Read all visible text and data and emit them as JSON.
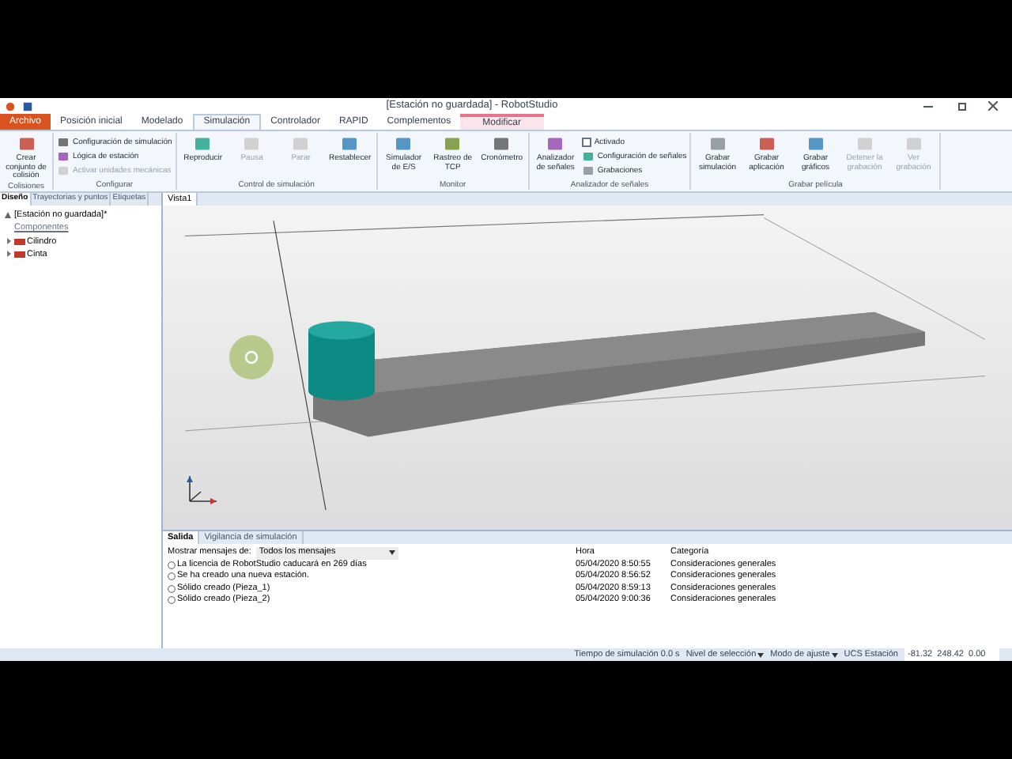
{
  "window": {
    "title": "[Estación no guardada] - RobotStudio"
  },
  "tabs": [
    {
      "label": "Archivo",
      "kind": "file",
      "selected": false
    },
    {
      "label": "Posición inicial",
      "kind": "tab",
      "selected": false
    },
    {
      "label": "Modelado",
      "kind": "tab",
      "selected": false
    },
    {
      "label": "Simulación",
      "kind": "tab",
      "selected": true
    },
    {
      "label": "Controlador",
      "kind": "tab",
      "selected": false
    },
    {
      "label": "RAPID",
      "kind": "tab",
      "selected": false
    },
    {
      "label": "Complementos",
      "kind": "tab",
      "selected": false
    },
    {
      "label": "Modificar",
      "kind": "contextual",
      "selected": false
    }
  ],
  "ribbon": [
    {
      "label": "Colisiones",
      "items": [
        {
          "kind": "large",
          "label": "Crear conjunto de colisión",
          "disabled": false
        }
      ]
    },
    {
      "label": "Configurar",
      "items": [
        {
          "kind": "small",
          "label": "Configuración de simulación",
          "disabled": false
        },
        {
          "kind": "small",
          "label": "Lógica de estación",
          "disabled": false
        },
        {
          "kind": "small",
          "label": "Activar unidades mecánicas",
          "disabled": true
        }
      ]
    },
    {
      "label": "Control de simulación",
      "items": [
        {
          "kind": "large",
          "label": "Reproducir",
          "disabled": false
        },
        {
          "kind": "large",
          "label": "Pausa",
          "disabled": true
        },
        {
          "kind": "large",
          "label": "Parar",
          "disabled": true
        },
        {
          "kind": "large",
          "label": "Restablecer",
          "disabled": false
        }
      ]
    },
    {
      "label": "Monitor",
      "items": [
        {
          "kind": "large",
          "label": "Simulador de E/S",
          "disabled": false
        },
        {
          "kind": "large",
          "label": "Rastreo de TCP",
          "disabled": false
        },
        {
          "kind": "large",
          "label": "Cronómetro",
          "disabled": false
        }
      ]
    },
    {
      "label": "Analizador de señales",
      "items": [
        {
          "kind": "large",
          "label": "Analizador de señales",
          "disabled": false
        },
        {
          "kind": "check",
          "label": "Activado",
          "checked": false
        },
        {
          "kind": "small",
          "label": "Configuración de señales",
          "disabled": false
        },
        {
          "kind": "small",
          "label": "Grabaciones",
          "disabled": false
        }
      ]
    },
    {
      "label": "Grabar película",
      "items": [
        {
          "kind": "large",
          "label": "Grabar simulación",
          "disabled": false
        },
        {
          "kind": "large",
          "label": "Grabar aplicación",
          "disabled": false
        },
        {
          "kind": "large",
          "label": "Grabar gráficos",
          "disabled": false
        },
        {
          "kind": "large",
          "label": "Detener la grabación",
          "disabled": true
        },
        {
          "kind": "large",
          "label": "Ver grabación",
          "disabled": true
        }
      ]
    }
  ],
  "left_panel": {
    "tabs": [
      {
        "label": "Diseño",
        "selected": true
      },
      {
        "label": "Trayectorias y puntos",
        "selected": false
      },
      {
        "label": "Etiquetas",
        "selected": false
      }
    ],
    "tree": {
      "label": "[Estación no guardada]*",
      "section": "Componentes",
      "children": [
        {
          "label": "Cilindro",
          "expanded": false
        },
        {
          "label": "Cinta",
          "expanded": false
        }
      ]
    }
  },
  "viewport": {
    "tab": "Vista1"
  },
  "output": {
    "tabs": [
      {
        "label": "Salida",
        "selected": true
      },
      {
        "label": "Vigilancia de simulación",
        "selected": false
      }
    ],
    "filter_label": "Mostrar mensajes de:",
    "filter_value": "Todos los mensajes",
    "columns": [
      "Hora",
      "Categoría"
    ],
    "rows": [
      {
        "message": "La licencia de RobotStudio caducará en 269 días",
        "time": "05/04/2020 8:50:55",
        "category": "Consideraciones generales"
      },
      {
        "message": "Se ha creado una nueva estación.",
        "time": "05/04/2020 8:56:52",
        "category": "Consideraciones generales"
      },
      {
        "message": "Sólido creado (Pieza_1)",
        "time": "05/04/2020 8:59:13",
        "category": "Consideraciones generales"
      },
      {
        "message": "Sólido creado (Pieza_2)",
        "time": "05/04/2020 9:00:36",
        "category": "Consideraciones generales"
      }
    ]
  },
  "status_bar": {
    "sim_time": "Tiempo de simulación 0.0 s",
    "selection_level": "Nivel de selección",
    "snap_mode": "Modo de ajuste",
    "ucs_label": "UCS Estación",
    "coordinates": "-81.32  248.42  0.00"
  }
}
